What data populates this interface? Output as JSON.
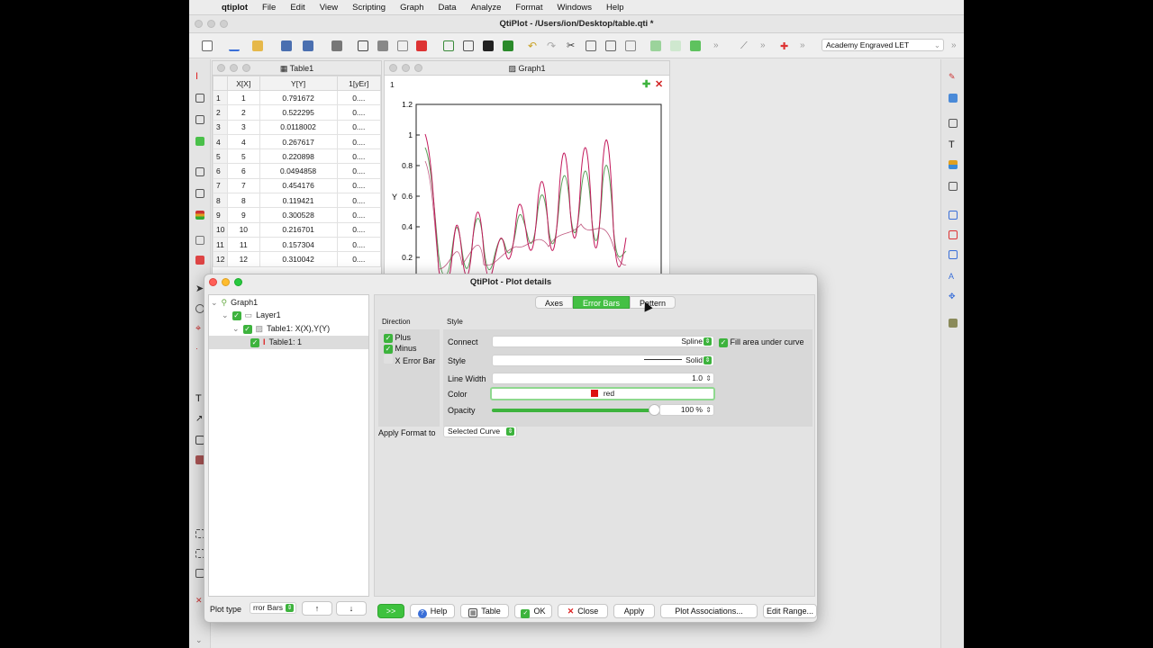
{
  "menubar": {
    "apple": "",
    "app": "qtiplot",
    "items": [
      "File",
      "Edit",
      "View",
      "Scripting",
      "Graph",
      "Data",
      "Analyze",
      "Format",
      "Windows",
      "Help"
    ]
  },
  "window": {
    "title": "QtiPlot - /Users/ion/Desktop/table.qti *"
  },
  "toolbar": {
    "font_select": "Academy Engraved LET"
  },
  "table1": {
    "title": "Table1",
    "columns": [
      "X[X]",
      "Y[Y]",
      "1[yEr]"
    ],
    "rows": [
      [
        "1",
        "1",
        "0.791672",
        "0...."
      ],
      [
        "2",
        "2",
        "0.522295",
        "0...."
      ],
      [
        "3",
        "3",
        "0.0118002",
        "0...."
      ],
      [
        "4",
        "4",
        "0.267617",
        "0...."
      ],
      [
        "5",
        "5",
        "0.220898",
        "0...."
      ],
      [
        "6",
        "6",
        "0.0494858",
        "0...."
      ],
      [
        "7",
        "7",
        "0.454176",
        "0...."
      ],
      [
        "8",
        "8",
        "0.119421",
        "0...."
      ],
      [
        "9",
        "9",
        "0.300528",
        "0...."
      ],
      [
        "10",
        "10",
        "0.216701",
        "0...."
      ],
      [
        "11",
        "11",
        "0.157304",
        "0...."
      ],
      [
        "12",
        "12",
        "0.310042",
        "0...."
      ]
    ]
  },
  "graph1": {
    "title": "Graph1",
    "layer_tab": "1",
    "y_axis_label": "Y",
    "y_ticks": [
      "1.2",
      "1",
      "0.8",
      "0.6",
      "0.4",
      "0.2"
    ],
    "colors": {
      "main_curve": "#c2185b",
      "error_curve": "#5aa05a",
      "add_icon": "#3db33d",
      "close_icon": "#d22222"
    }
  },
  "dialog": {
    "title": "QtiPlot - Plot details",
    "tree": {
      "graph": "Graph1",
      "layer": "Layer1",
      "curve": "Table1: X(X),Y(Y)",
      "errorbars": "Table1: 1"
    },
    "tabs": {
      "axes": "Axes",
      "error_bars": "Error Bars",
      "pattern": "Pattern"
    },
    "direction": {
      "heading": "Direction",
      "plus": "Plus",
      "minus": "Minus",
      "x_error_bar": "X Error Bar"
    },
    "style": {
      "heading": "Style",
      "connect_label": "Connect",
      "connect_value": "Spline",
      "fill_area": "Fill area under curve",
      "style_label": "Style",
      "style_value": "Solid",
      "line_width_label": "Line Width",
      "line_width_value": "1.0",
      "color_label": "Color",
      "color_value": "red",
      "color_swatch": "#dd1111",
      "opacity_label": "Opacity",
      "opacity_value": "100 %",
      "opacity_level_percent": 100
    },
    "apply_format": {
      "label": "Apply Format to",
      "value": "Selected Curve"
    },
    "bottom": {
      "plot_type_label": "Plot type",
      "plot_type_value": "rror Bars",
      "expand": ">>",
      "help": "Help",
      "table": "Table",
      "ok": "OK",
      "close": "Close",
      "apply": "Apply",
      "plot_associations": "Plot Associations...",
      "edit_range": "Edit Range..."
    }
  }
}
